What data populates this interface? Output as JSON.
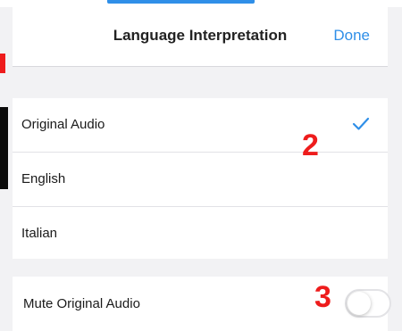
{
  "header": {
    "title": "Language Interpretation",
    "done_label": "Done"
  },
  "languages": {
    "items": [
      {
        "label": "Original Audio",
        "selected": true
      },
      {
        "label": "English",
        "selected": false
      },
      {
        "label": "Italian",
        "selected": false
      }
    ]
  },
  "mute": {
    "label": "Mute Original Audio",
    "enabled": false
  },
  "annotations": {
    "step2": "2",
    "step3": "3"
  },
  "colors": {
    "accent": "#2f8fe8",
    "annotation_red": "#ee1c1c",
    "group_bg": "#f2f2f4"
  },
  "icons": {
    "selected_check": "checkmark-icon"
  }
}
